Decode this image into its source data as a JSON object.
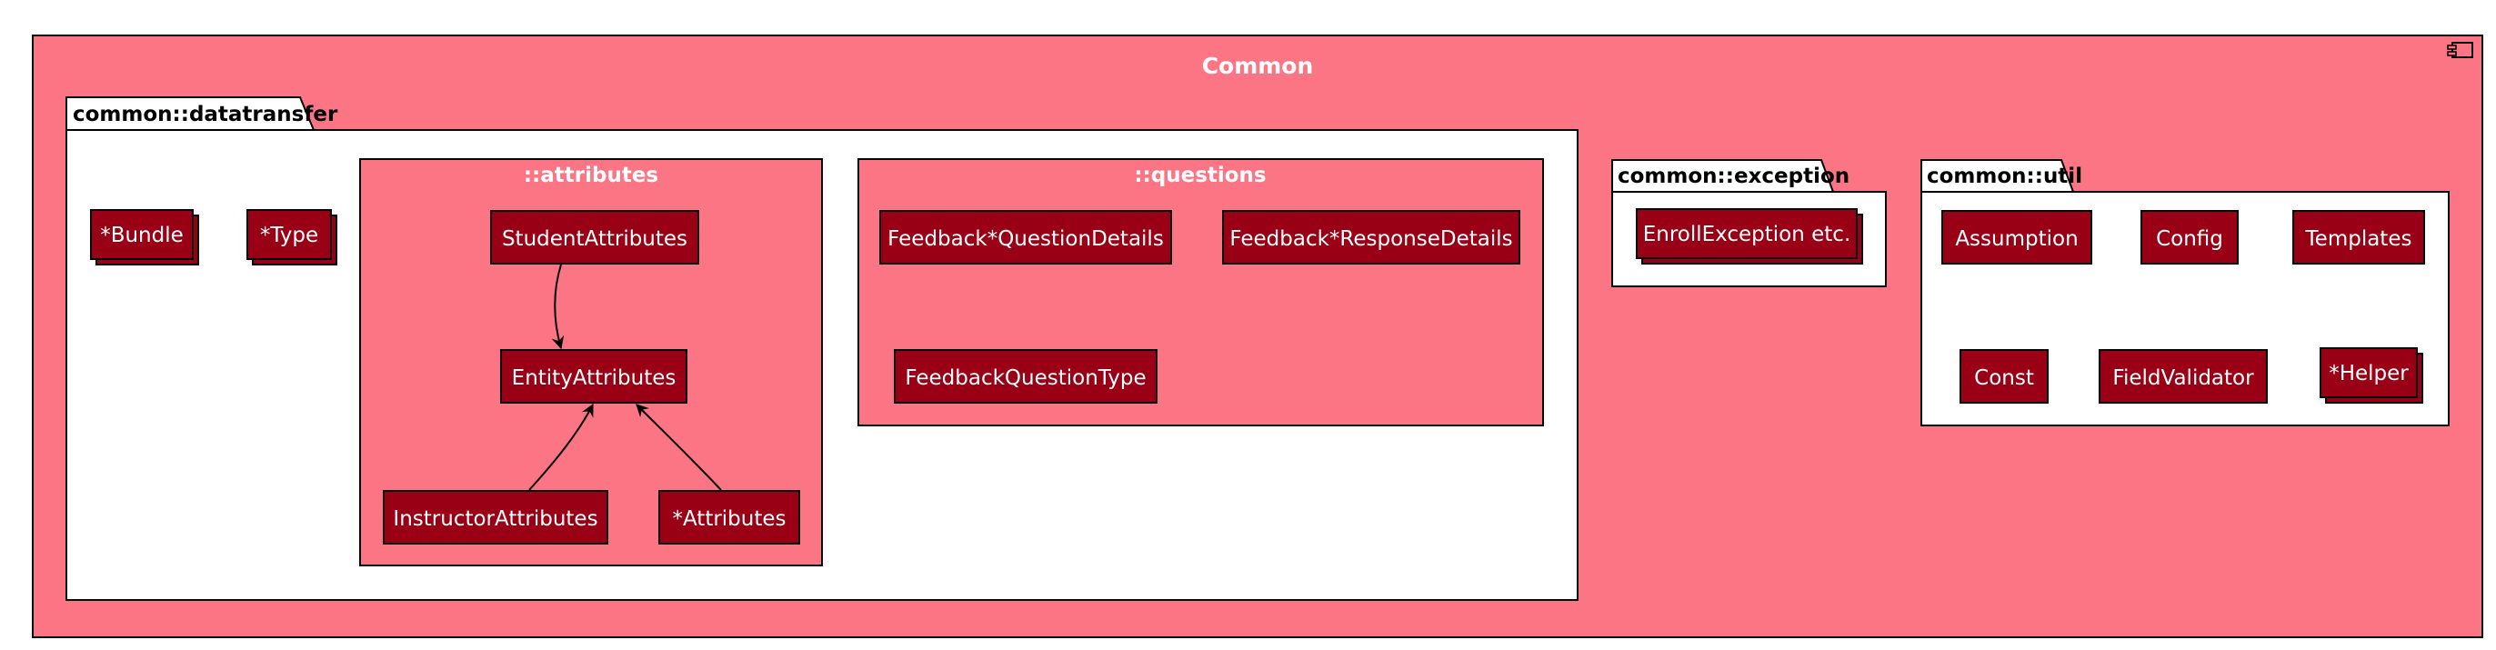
{
  "colors": {
    "component_fill": "#fb7585",
    "class_fill": "#9a0015",
    "border": "#000000",
    "package_fill": "#ffffff",
    "text_light": "#ffffff"
  },
  "component": {
    "title": "Common",
    "icon": "component-icon"
  },
  "packages": {
    "datatransfer": {
      "name": "common::datatransfer",
      "bundle": "*Bundle",
      "type": "*Type",
      "attributes": {
        "name": "::attributes",
        "student": "StudentAttributes",
        "entity": "EntityAttributes",
        "instructor": "InstructorAttributes",
        "other": "*Attributes"
      },
      "questions": {
        "name": "::questions",
        "question_details": "Feedback*QuestionDetails",
        "response_details": "Feedback*ResponseDetails",
        "question_type": "FeedbackQuestionType"
      }
    },
    "exception": {
      "name": "common::exception",
      "enroll": "EnrollException etc."
    },
    "util": {
      "name": "common::util",
      "assumption": "Assumption",
      "config": "Config",
      "templates": "Templates",
      "const": "Const",
      "field_validator": "FieldValidator",
      "helper": "*Helper"
    }
  }
}
